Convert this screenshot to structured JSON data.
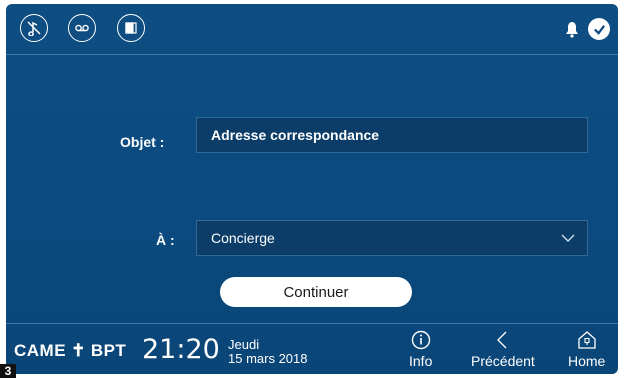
{
  "topbar": {
    "icons": [
      "do-not-disturb-icon",
      "voicemail-icon",
      "door-access-icon"
    ],
    "right_icons": [
      "bell-icon",
      "check-icon"
    ]
  },
  "form": {
    "subject_label": "Objet :",
    "subject_value": "Adresse correspondance",
    "to_label": "À :",
    "to_value": "Concierge",
    "continue_label": "Continuer"
  },
  "footer": {
    "brand_left": "CAME",
    "brand_right": "BPT",
    "time": "21:20",
    "day": "Jeudi",
    "date": "15 mars 2018",
    "nav": [
      {
        "label": "Info",
        "icon": "info-icon"
      },
      {
        "label": "Précédent",
        "icon": "chevron-left-icon"
      },
      {
        "label": "Home",
        "icon": "home-icon"
      }
    ]
  },
  "page_number": "3",
  "colors": {
    "background": "#0b4a7f",
    "field": "#0b3d68",
    "border": "#3f7aa8"
  }
}
